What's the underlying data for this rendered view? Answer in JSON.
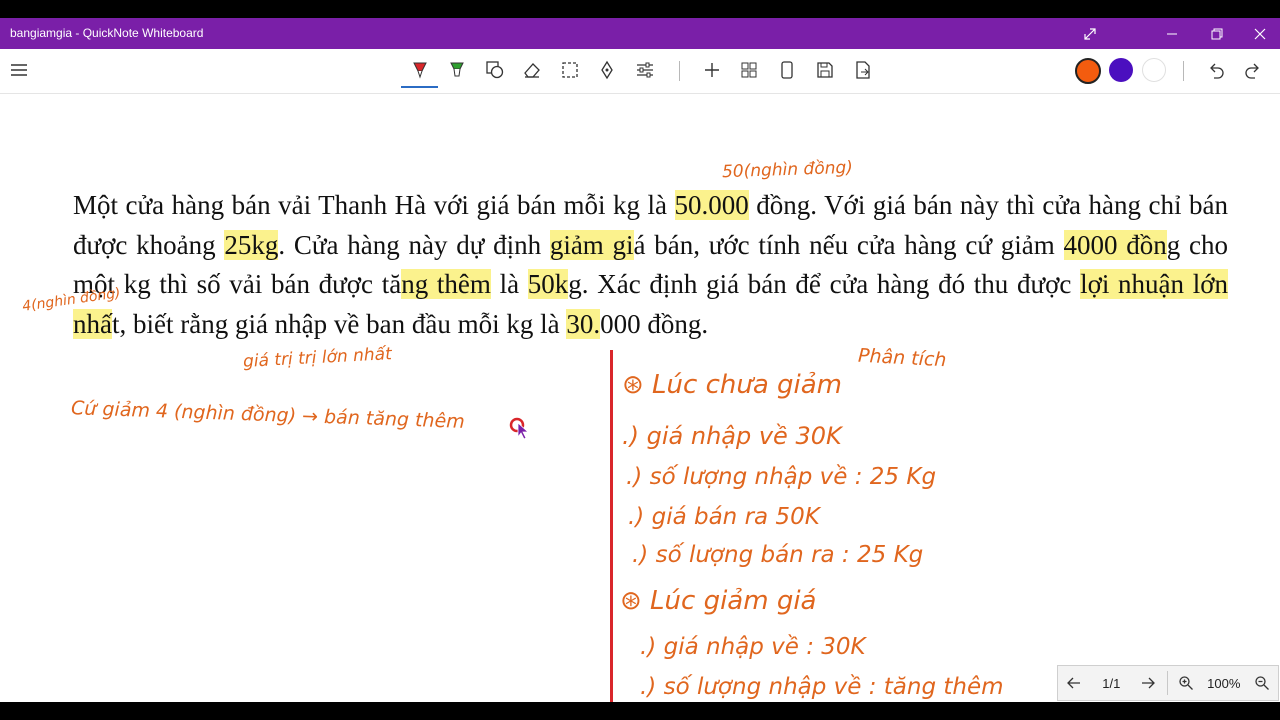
{
  "window": {
    "title": "bangiamgia - QuickNote Whiteboard",
    "accent": "#7a1fa8"
  },
  "toolbar": {
    "left_icon": "hamburger-menu-icon",
    "tools": [
      "pen-icon",
      "highlighter-icon",
      "shapes-icon",
      "eraser-icon",
      "lasso-select-icon",
      "pan-icon",
      "settings-sliders-icon"
    ],
    "actions": [
      "add-icon",
      "grid-icon",
      "page-icon",
      "save-icon",
      "export-icon"
    ],
    "colors": [
      "#f35c0f",
      "#4b0fbf",
      "#ffffff"
    ],
    "history": [
      "undo-icon",
      "redo-icon"
    ]
  },
  "problem": {
    "p1": "Một cửa hàng bán vải Thanh Hà với giá bán mỗi kg là ",
    "h1": "50.000",
    "p2": " đồng. Với giá bán này thì cửa hàng chỉ bán được khoảng ",
    "h2": "25kg",
    "p3": ". Cửa hàng này dự định ",
    "h3": "giảm gi",
    "p4": "á bán, ước tính nếu cửa hàng cứ giảm ",
    "h4": "4000 đồn",
    "p5": "g cho một kg thì số vải bán được tă",
    "h5": "ng thêm",
    "p6": " là ",
    "h6": "50k",
    "p7": "g. Xác định giá bán để cửa hàng đó thu được ",
    "h7": "lợi nhuận lớn nhấ",
    "p8": "t, biết rằng giá nhập về ban đầu mỗi kg là ",
    "h8": "30.",
    "p9": "000 đồng."
  },
  "ink": {
    "n1": "50(nghìn đồng)",
    "n2": "4(nghìn đồng)",
    "n3": "giá trị trị lớn nhất",
    "n4": "Cứ giảm 4 (nghìn đồng) → bán tăng thêm",
    "n5": "Phân tích",
    "n6": "⊛ Lúc chưa giảm",
    "n7": ".) giá nhập về 30K",
    "n8": ".) số lượng nhập về : 25 Kg",
    "n9": ".) giá bán ra 50K",
    "n10": ".) số lượng bán ra : 25 Kg",
    "n11": "⊛ Lúc giảm giá",
    "n12": ".) giá nhập về : 30K",
    "n13": ".) số lượng nhập về : tăng thêm",
    "ink_color": "#e0661e",
    "divider_color": "#d9262a"
  },
  "nav": {
    "page": "1/1",
    "zoom": "100%"
  }
}
